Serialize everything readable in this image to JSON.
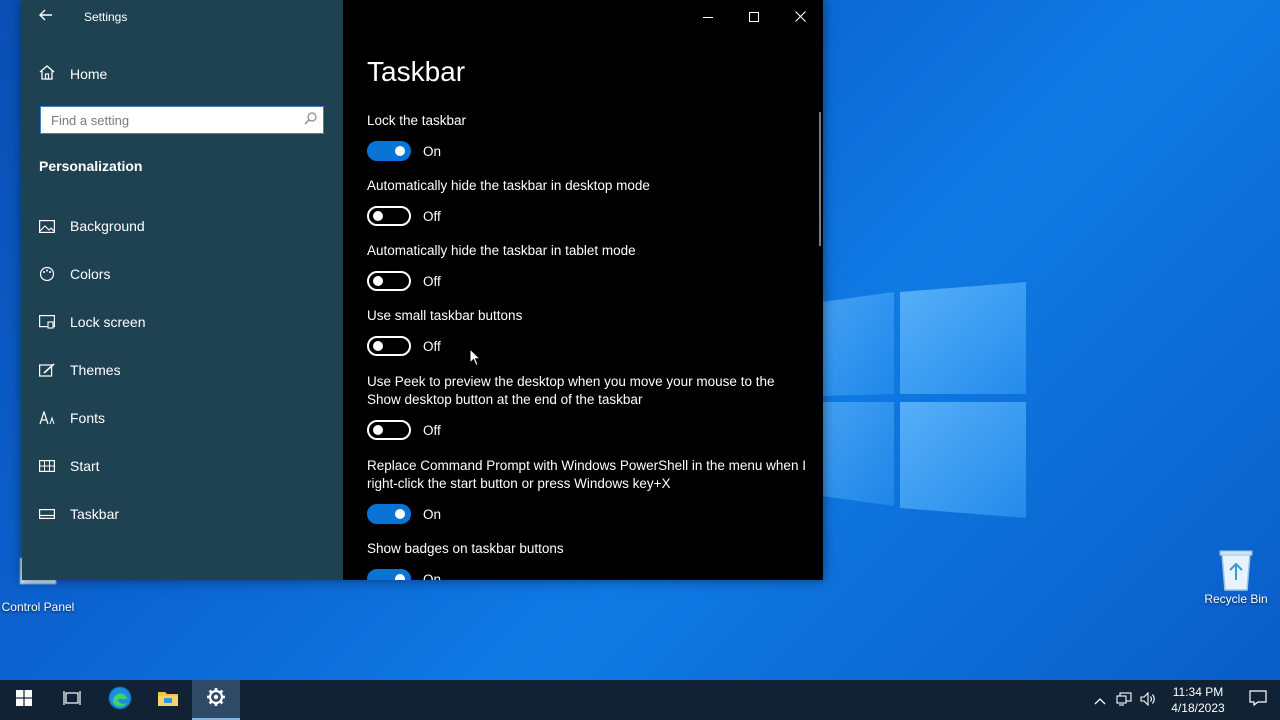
{
  "window": {
    "title": "Settings",
    "back_icon": "back-arrow-icon",
    "controls": [
      "minimize-icon",
      "maximize-icon",
      "close-icon"
    ]
  },
  "sidebar": {
    "home_label": "Home",
    "search_placeholder": "Find a setting",
    "section_title": "Personalization",
    "items": [
      {
        "label": "Background",
        "icon": "image-icon"
      },
      {
        "label": "Colors",
        "icon": "palette-icon"
      },
      {
        "label": "Lock screen",
        "icon": "lock-screen-icon"
      },
      {
        "label": "Themes",
        "icon": "brush-icon"
      },
      {
        "label": "Fonts",
        "icon": "fonts-icon"
      },
      {
        "label": "Start",
        "icon": "start-grid-icon"
      },
      {
        "label": "Taskbar",
        "icon": "taskbar-icon",
        "selected": true
      }
    ]
  },
  "main": {
    "page_title": "Taskbar",
    "settings": [
      {
        "label": "Lock the taskbar",
        "state": "On"
      },
      {
        "label": "Automatically hide the taskbar in desktop mode",
        "state": "Off"
      },
      {
        "label": "Automatically hide the taskbar in tablet mode",
        "state": "Off"
      },
      {
        "label": "Use small taskbar buttons",
        "state": "Off"
      },
      {
        "label": "Use Peek to preview the desktop when you move your mouse to the Show desktop button at the end of the taskbar",
        "state": "Off"
      },
      {
        "label": "Replace Command Prompt with Windows PowerShell in the menu when I right-click the start button or press Windows key+X",
        "state": "On"
      },
      {
        "label": "Show badges on taskbar buttons",
        "state": "On"
      }
    ]
  },
  "desktop": {
    "icons": [
      {
        "label": "Control Panel",
        "icon": "control-panel-icon"
      },
      {
        "label": "Recycle Bin",
        "icon": "recycle-bin-icon"
      }
    ]
  },
  "taskbar": {
    "buttons": [
      "windows-start-icon",
      "task-view-icon",
      "edge-icon",
      "file-explorer-icon",
      "settings-gear-icon"
    ],
    "tray_icons": [
      "chevron-up-icon",
      "network-icon",
      "volume-icon"
    ],
    "time": "11:34 PM",
    "date": "4/18/2023",
    "notification_icon": "action-center-icon"
  },
  "colors": {
    "accent": "#0a74d6",
    "sidebar_bg": "#1f4252",
    "content_bg": "#000000",
    "taskbar_bg": "#102234"
  }
}
